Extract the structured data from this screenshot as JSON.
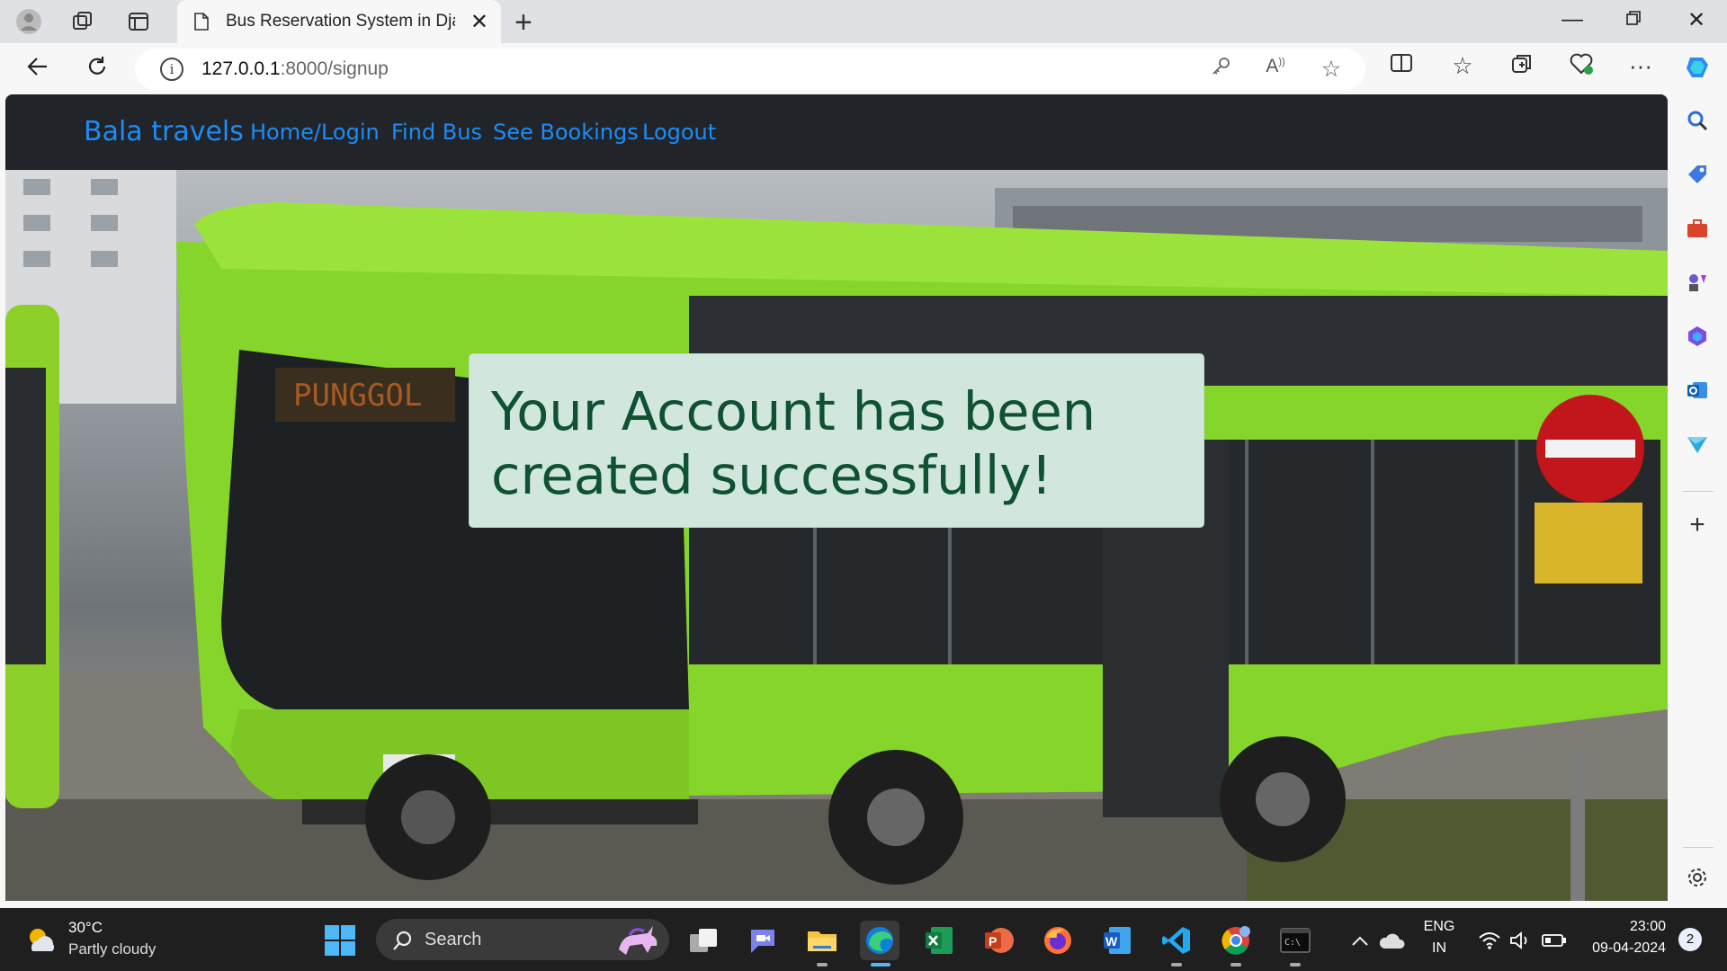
{
  "browser": {
    "tab_title": "Bus Reservation System in Django",
    "url_host": "127.0.0.1",
    "url_path": ":8000/signup"
  },
  "navbar": {
    "brand": "Bala travels",
    "links": [
      "Home/Login",
      "Find Bus",
      "See Bookings",
      "Logout"
    ]
  },
  "alert": {
    "message": "Your Account has been created successfully!"
  },
  "taskbar": {
    "temperature": "30°C",
    "condition": "Partly cloudy",
    "search_label": "Search",
    "language": "ENG",
    "region": "IN",
    "time": "23:00",
    "date": "09-04-2024",
    "notification_count": "2"
  }
}
